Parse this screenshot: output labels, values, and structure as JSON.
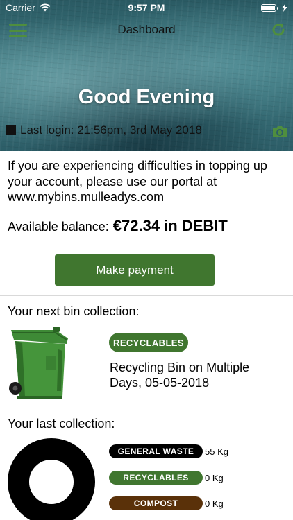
{
  "status_bar": {
    "carrier": "Carrier",
    "time": "9:57 PM"
  },
  "header": {
    "title": "Dashboard",
    "greeting": "Good Evening",
    "last_login": "Last login: 21:56pm, 3rd May 2018"
  },
  "notice": "If you are experiencing difficulties in topping up your account, please use our portal at www.mybins.mulleadys.com",
  "balance": {
    "label": "Available balance:",
    "value": "€72.34 in DEBIT"
  },
  "payment_button_label": "Make payment",
  "next_collection": {
    "title": "Your next bin collection:",
    "badge": "RECYCLABLES",
    "description": "Recycling Bin on Multiple Days, 05-05-2018"
  },
  "last_collection": {
    "title": "Your last collection:",
    "items": [
      {
        "label": "GENERAL WASTE",
        "value": "55 Kg",
        "color": "#000000"
      },
      {
        "label": "RECYCLABLES",
        "value": "0 Kg",
        "color": "#40762f"
      },
      {
        "label": "COMPOST",
        "value": "0 Kg",
        "color": "#5a3109"
      }
    ]
  },
  "colors": {
    "accent_green": "#40762f",
    "compost_brown": "#5a3109",
    "general_black": "#000000"
  }
}
